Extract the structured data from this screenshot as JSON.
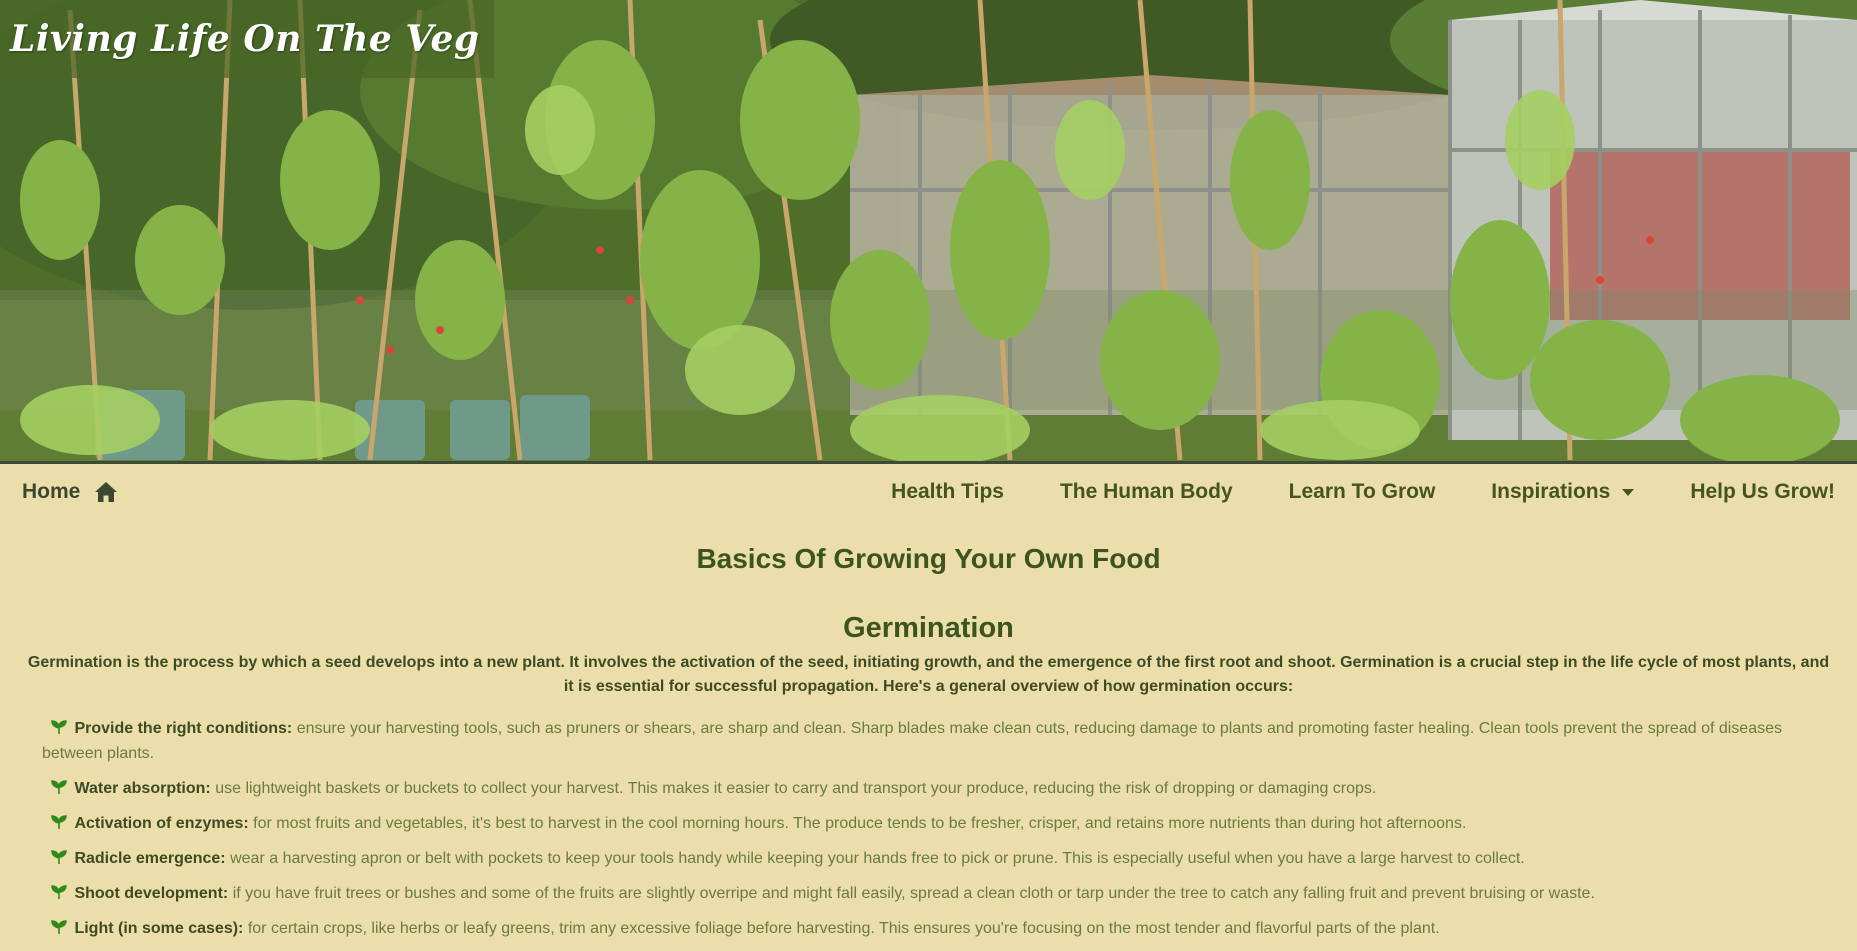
{
  "site": {
    "title": "Living Life On The Veg"
  },
  "nav": {
    "home_label": "Home",
    "items": [
      {
        "label": "Health Tips"
      },
      {
        "label": "The Human Body"
      },
      {
        "label": "Learn To Grow"
      },
      {
        "label": "Inspirations"
      },
      {
        "label": "Help Us Grow!"
      }
    ]
  },
  "main": {
    "page_title": "Basics Of Growing Your Own Food",
    "section_title": "Germination",
    "intro": "Germination is the process by which a seed develops into a new plant. It involves the activation of the seed, initiating growth, and the emergence of the first root and shoot. Germination is a crucial step in the life cycle of most plants, and it is essential for successful propagation. Here's a general overview of how germination occurs:",
    "steps": [
      {
        "label": "Provide the right conditions:",
        "text": "ensure your harvesting tools, such as pruners or shears, are sharp and clean. Sharp blades make clean cuts, reducing damage to plants and promoting faster healing. Clean tools prevent the spread of diseases between plants."
      },
      {
        "label": "Water absorption:",
        "text": "use lightweight baskets or buckets to collect your harvest. This makes it easier to carry and transport your produce, reducing the risk of dropping or damaging crops."
      },
      {
        "label": "Activation of enzymes:",
        "text": "for most fruits and vegetables, it's best to harvest in the cool morning hours. The produce tends to be fresher, crisper, and retains more nutrients than during hot afternoons."
      },
      {
        "label": "Radicle emergence:",
        "text": "wear a harvesting apron or belt with pockets to keep your tools handy while keeping your hands free to pick or prune. This is especially useful when you have a large harvest to collect."
      },
      {
        "label": "Shoot development:",
        "text": "if you have fruit trees or bushes and some of the fruits are slightly overripe and might fall easily, spread a clean cloth or tarp under the tree to catch any falling fruit and prevent bruising or waste."
      },
      {
        "label": "Light (in some cases):",
        "text": "for certain crops, like herbs or leafy greens, trim any excessive foliage before harvesting. This ensures you're focusing on the most tender and flavorful parts of the plant."
      }
    ]
  },
  "icons": {
    "home": "home-icon",
    "bullet": "sprout-icon",
    "dropdown": "chevron-down-icon"
  },
  "colors": {
    "page_background": "#ebdeaa",
    "heading_green": "#3c5420",
    "nav_text": "#44561c",
    "body_text": "#6a7a45",
    "sprout_green": "#2e8b1a",
    "title_box": "#4a6626"
  }
}
